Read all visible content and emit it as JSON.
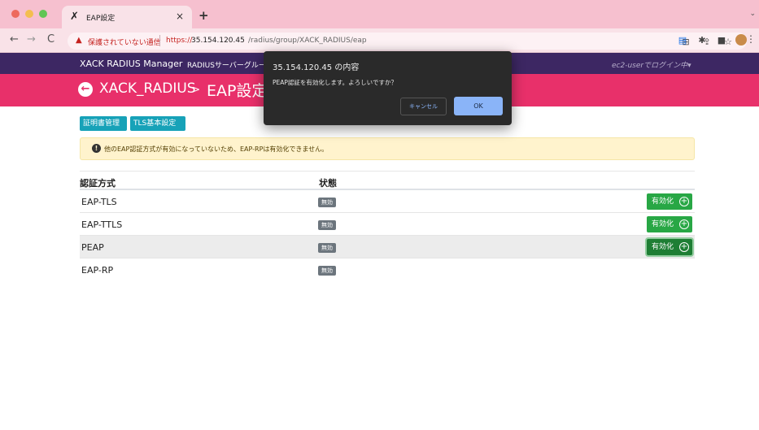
{
  "browser": {
    "tab_icon": "xack-logo-icon",
    "tab_title": "EAP設定",
    "tab_close": "×",
    "new_tab": "+",
    "security_label": "保護されていない通信",
    "url_https": "https://",
    "url_host": "35.154.120.45",
    "url_path": "/radius/group/XACK_RADIUS/eap"
  },
  "navbar": {
    "brand": "XACK RADIUS Manager",
    "link": "RADIUSサーバーグルー",
    "user": "ec2-userでログイン中▾",
    "background": "#3d2763"
  },
  "header": {
    "title": "XACK_RADIUS",
    "arrow": ">",
    "subtitle": "EAP設定",
    "background": "#e8306a"
  },
  "toolbar_buttons": {
    "cert_label": "証明書管理",
    "tls_label": "TLS基本設定"
  },
  "alert": {
    "text": "他のEAP認証方式が有効になっていないため、EAP-RPは有効化できません。"
  },
  "table": {
    "headers": {
      "name": "認証方式",
      "status": "状態"
    },
    "rows": [
      {
        "name": "EAP-TLS",
        "status": "無効",
        "action": "有効化"
      },
      {
        "name": "EAP-TTLS",
        "status": "無効",
        "action": "有効化"
      },
      {
        "name": "PEAP",
        "status": "無効",
        "action": "有効化"
      },
      {
        "name": "EAP-RP",
        "status": "無効"
      }
    ]
  },
  "dialog": {
    "title": "35.154.120.45 の内容",
    "message": "PEAP認証を有効化します。よろしいですか？",
    "cancel_label": "キャンセル",
    "ok_label": "OK"
  }
}
